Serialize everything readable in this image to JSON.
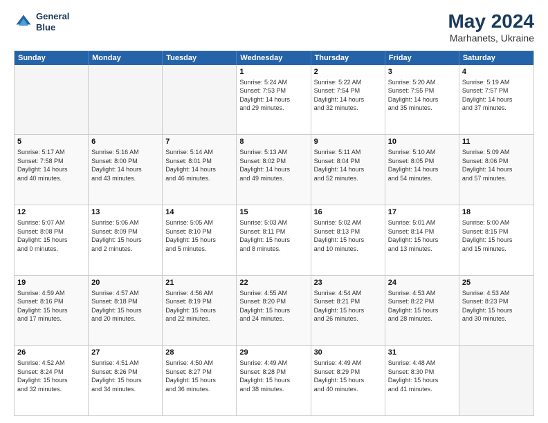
{
  "header": {
    "logo_line1": "General",
    "logo_line2": "Blue",
    "month": "May 2024",
    "location": "Marhanets, Ukraine"
  },
  "weekdays": [
    "Sunday",
    "Monday",
    "Tuesday",
    "Wednesday",
    "Thursday",
    "Friday",
    "Saturday"
  ],
  "rows": [
    [
      {
        "day": "",
        "text": "",
        "empty": true
      },
      {
        "day": "",
        "text": "",
        "empty": true
      },
      {
        "day": "",
        "text": "",
        "empty": true
      },
      {
        "day": "1",
        "text": "Sunrise: 5:24 AM\nSunset: 7:53 PM\nDaylight: 14 hours\nand 29 minutes."
      },
      {
        "day": "2",
        "text": "Sunrise: 5:22 AM\nSunset: 7:54 PM\nDaylight: 14 hours\nand 32 minutes."
      },
      {
        "day": "3",
        "text": "Sunrise: 5:20 AM\nSunset: 7:55 PM\nDaylight: 14 hours\nand 35 minutes."
      },
      {
        "day": "4",
        "text": "Sunrise: 5:19 AM\nSunset: 7:57 PM\nDaylight: 14 hours\nand 37 minutes."
      }
    ],
    [
      {
        "day": "5",
        "text": "Sunrise: 5:17 AM\nSunset: 7:58 PM\nDaylight: 14 hours\nand 40 minutes."
      },
      {
        "day": "6",
        "text": "Sunrise: 5:16 AM\nSunset: 8:00 PM\nDaylight: 14 hours\nand 43 minutes."
      },
      {
        "day": "7",
        "text": "Sunrise: 5:14 AM\nSunset: 8:01 PM\nDaylight: 14 hours\nand 46 minutes."
      },
      {
        "day": "8",
        "text": "Sunrise: 5:13 AM\nSunset: 8:02 PM\nDaylight: 14 hours\nand 49 minutes."
      },
      {
        "day": "9",
        "text": "Sunrise: 5:11 AM\nSunset: 8:04 PM\nDaylight: 14 hours\nand 52 minutes."
      },
      {
        "day": "10",
        "text": "Sunrise: 5:10 AM\nSunset: 8:05 PM\nDaylight: 14 hours\nand 54 minutes."
      },
      {
        "day": "11",
        "text": "Sunrise: 5:09 AM\nSunset: 8:06 PM\nDaylight: 14 hours\nand 57 minutes."
      }
    ],
    [
      {
        "day": "12",
        "text": "Sunrise: 5:07 AM\nSunset: 8:08 PM\nDaylight: 15 hours\nand 0 minutes."
      },
      {
        "day": "13",
        "text": "Sunrise: 5:06 AM\nSunset: 8:09 PM\nDaylight: 15 hours\nand 2 minutes."
      },
      {
        "day": "14",
        "text": "Sunrise: 5:05 AM\nSunset: 8:10 PM\nDaylight: 15 hours\nand 5 minutes."
      },
      {
        "day": "15",
        "text": "Sunrise: 5:03 AM\nSunset: 8:11 PM\nDaylight: 15 hours\nand 8 minutes."
      },
      {
        "day": "16",
        "text": "Sunrise: 5:02 AM\nSunset: 8:13 PM\nDaylight: 15 hours\nand 10 minutes."
      },
      {
        "day": "17",
        "text": "Sunrise: 5:01 AM\nSunset: 8:14 PM\nDaylight: 15 hours\nand 13 minutes."
      },
      {
        "day": "18",
        "text": "Sunrise: 5:00 AM\nSunset: 8:15 PM\nDaylight: 15 hours\nand 15 minutes."
      }
    ],
    [
      {
        "day": "19",
        "text": "Sunrise: 4:59 AM\nSunset: 8:16 PM\nDaylight: 15 hours\nand 17 minutes."
      },
      {
        "day": "20",
        "text": "Sunrise: 4:57 AM\nSunset: 8:18 PM\nDaylight: 15 hours\nand 20 minutes."
      },
      {
        "day": "21",
        "text": "Sunrise: 4:56 AM\nSunset: 8:19 PM\nDaylight: 15 hours\nand 22 minutes."
      },
      {
        "day": "22",
        "text": "Sunrise: 4:55 AM\nSunset: 8:20 PM\nDaylight: 15 hours\nand 24 minutes."
      },
      {
        "day": "23",
        "text": "Sunrise: 4:54 AM\nSunset: 8:21 PM\nDaylight: 15 hours\nand 26 minutes."
      },
      {
        "day": "24",
        "text": "Sunrise: 4:53 AM\nSunset: 8:22 PM\nDaylight: 15 hours\nand 28 minutes."
      },
      {
        "day": "25",
        "text": "Sunrise: 4:53 AM\nSunset: 8:23 PM\nDaylight: 15 hours\nand 30 minutes."
      }
    ],
    [
      {
        "day": "26",
        "text": "Sunrise: 4:52 AM\nSunset: 8:24 PM\nDaylight: 15 hours\nand 32 minutes."
      },
      {
        "day": "27",
        "text": "Sunrise: 4:51 AM\nSunset: 8:26 PM\nDaylight: 15 hours\nand 34 minutes."
      },
      {
        "day": "28",
        "text": "Sunrise: 4:50 AM\nSunset: 8:27 PM\nDaylight: 15 hours\nand 36 minutes."
      },
      {
        "day": "29",
        "text": "Sunrise: 4:49 AM\nSunset: 8:28 PM\nDaylight: 15 hours\nand 38 minutes."
      },
      {
        "day": "30",
        "text": "Sunrise: 4:49 AM\nSunset: 8:29 PM\nDaylight: 15 hours\nand 40 minutes."
      },
      {
        "day": "31",
        "text": "Sunrise: 4:48 AM\nSunset: 8:30 PM\nDaylight: 15 hours\nand 41 minutes."
      },
      {
        "day": "",
        "text": "",
        "empty": true
      }
    ]
  ]
}
